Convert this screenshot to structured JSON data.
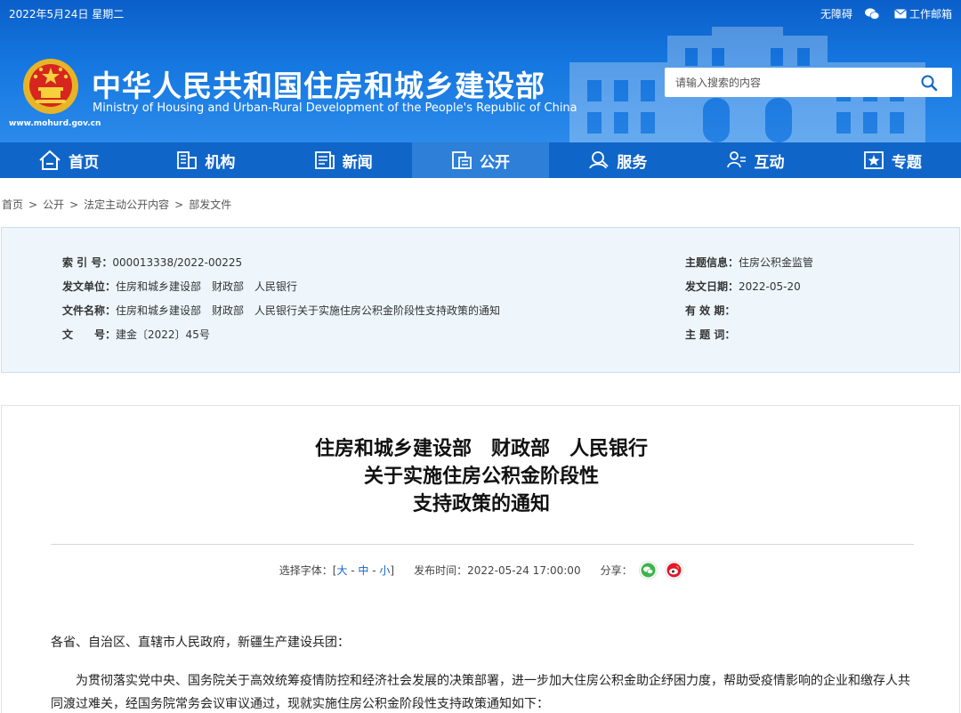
{
  "topbar": {
    "date": "2022年5月24日 星期二",
    "accessibility": "无障碍",
    "email": "工作邮箱"
  },
  "site": {
    "name_cn": "中华人民共和国住房和城乡建设部",
    "name_en": "Ministry of Housing and Urban-Rural Development of the People's Republic of China",
    "url": "www.mohurd.gov.cn"
  },
  "search": {
    "placeholder": "请输入搜索的内容"
  },
  "nav": {
    "items": [
      {
        "label": "首页",
        "icon": "home-icon"
      },
      {
        "label": "机构",
        "icon": "building-icon"
      },
      {
        "label": "新闻",
        "icon": "news-icon"
      },
      {
        "label": "公开",
        "icon": "document-icon",
        "active": true
      },
      {
        "label": "服务",
        "icon": "service-icon"
      },
      {
        "label": "互动",
        "icon": "interaction-icon"
      },
      {
        "label": "专题",
        "icon": "star-icon"
      }
    ]
  },
  "breadcrumb": [
    "首页",
    "公开",
    "法定主动公开内容",
    "部发文件"
  ],
  "meta": {
    "index_key": "索 引 号：",
    "index_val": "000013338/2022-00225",
    "unit_key": "发文单位：",
    "unit_val": "住房和城乡建设部　财政部　人民银行",
    "docname_key": "文件名称：",
    "docname_val": "住房和城乡建设部　财政部　人民银行关于实施住房公积金阶段性支持政策的通知",
    "docno_key": "文　　号：",
    "docno_val": "建金〔2022〕45号",
    "topic_key": "主题信息：",
    "topic_val": "住房公积金监管",
    "date_key": "发文日期：",
    "date_val": "2022-05-20",
    "valid_key": "有 效 期：",
    "valid_val": "",
    "keywords_key": "主 题 词：",
    "keywords_val": ""
  },
  "article": {
    "title_line1": "住房和城乡建设部　财政部　人民银行",
    "title_line2": "关于实施住房公积金阶段性",
    "title_line3": "支持政策的通知",
    "font_label": "选择字体：[",
    "font_large": "大",
    "font_medium": "中",
    "font_small": "小",
    "font_close": "]",
    "publish_label": "发布时间：",
    "publish_time": "2022-05-24 17:00:00",
    "share_label": "分享：",
    "salutation": "各省、自治区、直辖市人民政府，新疆生产建设兵团：",
    "paragraph1": "为贯彻落实党中央、国务院关于高效统筹疫情防控和经济社会发展的决策部署，进一步加大住房公积金助企纾困力度，帮助受疫情影响的企业和缴存人共同渡过难关，经国务院常务会议审议通过，现就实施住房公积金阶段性支持政策通知如下："
  },
  "colors": {
    "header_blue": "#1577e0",
    "nav_blue": "#1065c9",
    "nav_active": "#2d7fd8",
    "meta_bg": "#eef6fc",
    "link_blue": "#1065c9"
  }
}
